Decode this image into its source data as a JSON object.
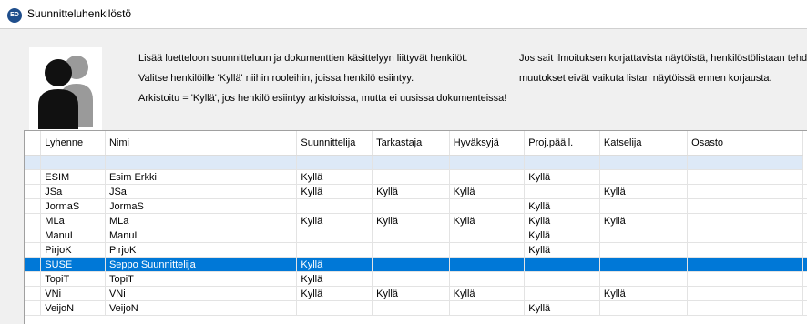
{
  "window": {
    "title": "Suunnitteluhenkilöstö",
    "icon_text": "ED"
  },
  "info": {
    "line1": "Lisää luetteloon suunnitteluun ja dokumenttien käsittelyyn liittyvät henkilöt.",
    "line2": "Valitse henkilöille 'Kyllä' niihin rooleihin, joissa henkilö esiintyy.",
    "line3": "Arkistoitu = 'Kyllä', jos henkilö esiintyy arkistoissa, mutta ei uusissa dokumenteissa!",
    "right1": "Jos sait ilmoituksen korjattavista näytöistä, henkilöstölistaan tehdyt",
    "right2": "muutokset eivät vaikuta listan näytöissä ennen korjausta."
  },
  "grid": {
    "headers": [
      "Lyhenne",
      "Nimi",
      "Suunnittelija",
      "Tarkastaja",
      "Hyväksyjä",
      "Proj.pääll.",
      "Katselija",
      "Osasto"
    ],
    "rows": [
      [
        "ESIM",
        "Esim Erkki",
        "Kyllä",
        "",
        "",
        "Kyllä",
        "",
        ""
      ],
      [
        "JSa",
        "JSa",
        "Kyllä",
        "Kyllä",
        "Kyllä",
        "",
        "Kyllä",
        ""
      ],
      [
        "JormaS",
        "JormaS",
        "",
        "",
        "",
        "Kyllä",
        "",
        ""
      ],
      [
        "MLa",
        "MLa",
        "Kyllä",
        "Kyllä",
        "Kyllä",
        "Kyllä",
        "Kyllä",
        ""
      ],
      [
        "ManuL",
        "ManuL",
        "",
        "",
        "",
        "Kyllä",
        "",
        ""
      ],
      [
        "PirjoK",
        "PirjoK",
        "",
        "",
        "",
        "Kyllä",
        "",
        ""
      ],
      [
        "SUSE",
        "Seppo Suunnittelija",
        "Kyllä",
        "",
        "",
        "",
        "",
        ""
      ],
      [
        "TopiT",
        "TopiT",
        "Kyllä",
        "",
        "",
        "",
        "",
        ""
      ],
      [
        "VNi",
        "VNi",
        "Kyllä",
        "Kyllä",
        "Kyllä",
        "",
        "Kyllä",
        ""
      ],
      [
        "VeijoN",
        "VeijoN",
        "",
        "",
        "",
        "Kyllä",
        "",
        ""
      ]
    ],
    "selected_index": 6
  }
}
